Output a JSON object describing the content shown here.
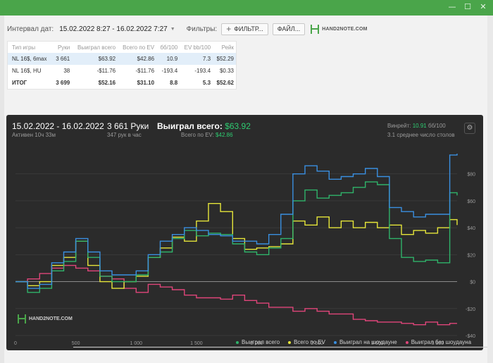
{
  "window": {
    "minimize_glyph": "—",
    "maximize_glyph": "☐",
    "close_glyph": "✕"
  },
  "toolbar": {
    "date_label": "Интервал дат:",
    "date_range": "15.02.2022 8:27 - 16.02.2022 7:27",
    "filters_label": "Фильтры:",
    "filter_button": "ФИЛЬТР...",
    "file_button": "ФАЙЛ...",
    "logo_text": "HAND2NOTE.COM"
  },
  "stats_table": {
    "headers": [
      "Тип игры",
      "Руки",
      "Выиграл всего",
      "Всего по EV",
      "бб/100",
      "EV bb/100",
      "Рейк"
    ],
    "rows": [
      {
        "game": "NL 16$, 6max",
        "hands": "3 661",
        "won": "$63.92",
        "ev": "$42.86",
        "bb100": "10.9",
        "evbb100": "7.3",
        "rake": "$52.29"
      },
      {
        "game": "NL 16$, HU",
        "hands": "38",
        "won": "-$11.76",
        "ev": "-$11.76",
        "bb100": "-193.4",
        "evbb100": "-193.4",
        "rake": "$0.33"
      }
    ],
    "total": {
      "game": "ИТОГ",
      "hands": "3 699",
      "won": "$52.16",
      "ev": "$31.10",
      "bb100": "8.8",
      "evbb100": "5.3",
      "rake": "$52.62"
    }
  },
  "panel": {
    "date_range": "15.02.2022 - 16.02.2022",
    "active": "Активен 10ч 33м",
    "hands": "3 661 Руки",
    "hands_per_hour": "347 рук в час",
    "won_label": "Выиграл всего:",
    "won_value": "$63.92",
    "ev_label": "Всего по EV:",
    "ev_value": "$42.86",
    "winrate_label": "Винрейт:",
    "winrate_value": "10.91",
    "winrate_unit": "бб/100",
    "avg_tables": "3.1 среднее число столов",
    "watermark": "HAND2NOTE.COM",
    "settings_icon": "⚙"
  },
  "colors": {
    "won": "#2fb36a",
    "ev": "#e6e63a",
    "showdown": "#3a8fe0",
    "non_showdown": "#e0457a",
    "brand": "#4aa54a"
  },
  "chart_data": {
    "type": "line",
    "xlabel": "",
    "ylabel": "",
    "xlim": [
      0,
      3661
    ],
    "ylim": [
      -40,
      95
    ],
    "x_ticks": [
      0,
      500,
      1000,
      1500,
      2000,
      2500,
      3000,
      3500
    ],
    "x_tick_labels": [
      "0",
      "500",
      "1 000",
      "1 500",
      "2 000",
      "2 500",
      "3 000",
      "3 500"
    ],
    "y_ticks": [
      80,
      60,
      40,
      20,
      0,
      -20,
      -40
    ],
    "y_tick_labels": [
      "$80",
      "$60",
      "$40",
      "$20",
      "$0",
      "-$20",
      "-$40"
    ],
    "x": [
      0,
      100,
      200,
      300,
      400,
      500,
      600,
      700,
      800,
      900,
      1000,
      1100,
      1200,
      1300,
      1400,
      1500,
      1600,
      1700,
      1800,
      1900,
      2000,
      2100,
      2200,
      2300,
      2400,
      2500,
      2600,
      2700,
      2800,
      2900,
      3000,
      3100,
      3200,
      3300,
      3400,
      3500,
      3600,
      3661
    ],
    "series": [
      {
        "name": "Выиграл всего",
        "values": [
          0,
          -8,
          -5,
          8,
          15,
          30,
          18,
          4,
          0,
          0,
          5,
          18,
          22,
          32,
          38,
          34,
          36,
          35,
          28,
          22,
          20,
          25,
          32,
          60,
          68,
          62,
          64,
          66,
          70,
          74,
          72,
          32,
          18,
          15,
          16,
          14,
          66,
          64
        ]
      },
      {
        "name": "Всего по EV",
        "values": [
          0,
          -3,
          0,
          12,
          18,
          30,
          12,
          0,
          -5,
          0,
          4,
          18,
          25,
          33,
          30,
          45,
          58,
          52,
          32,
          24,
          25,
          26,
          28,
          45,
          42,
          48,
          40,
          45,
          40,
          44,
          40,
          42,
          35,
          38,
          36,
          40,
          46,
          42
        ]
      },
      {
        "name": "Выиграл на шоудауне",
        "values": [
          0,
          -5,
          -2,
          14,
          22,
          32,
          22,
          8,
          5,
          5,
          8,
          20,
          30,
          35,
          40,
          38,
          35,
          34,
          30,
          30,
          28,
          35,
          50,
          80,
          86,
          82,
          76,
          78,
          80,
          84,
          78,
          55,
          52,
          48,
          50,
          50,
          94,
          95
        ]
      },
      {
        "name": "Выиграл без шоудауна",
        "values": [
          0,
          2,
          6,
          10,
          12,
          10,
          8,
          4,
          2,
          -5,
          -8,
          -2,
          -4,
          -6,
          -10,
          -12,
          -12,
          -13,
          -10,
          -14,
          -16,
          -19,
          -19,
          -22,
          -20,
          -22,
          -24,
          -24,
          -28,
          -29,
          -30,
          -30,
          -31,
          -32,
          -30,
          -32,
          -31,
          -31
        ]
      }
    ]
  },
  "legend_items": [
    "Выиграл всего",
    "Всего по EV",
    "Выиграл на шоудауне",
    "Выиграл без шоудауна"
  ]
}
